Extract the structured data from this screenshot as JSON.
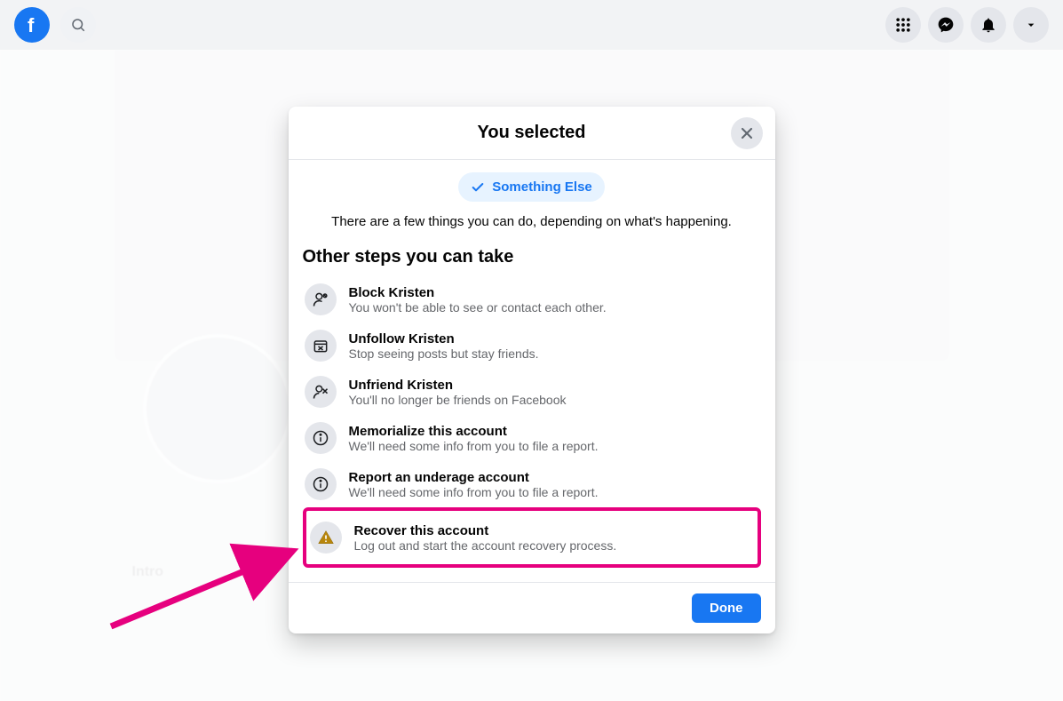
{
  "topbar": {
    "logo_letter": "f"
  },
  "profile": {
    "name": "Kristen",
    "info_label": "Intro"
  },
  "dialog": {
    "title": "You selected",
    "chip": "Something Else",
    "description": "There are a few things you can do, depending on what's happening.",
    "section": "Other steps you can take",
    "steps": [
      {
        "title": "Block Kristen",
        "sub": "You won't be able to see or contact each other."
      },
      {
        "title": "Unfollow Kristen",
        "sub": "Stop seeing posts but stay friends."
      },
      {
        "title": "Unfriend Kristen",
        "sub": "You'll no longer be friends on Facebook"
      },
      {
        "title": "Memorialize this account",
        "sub": "We'll need some info from you to file a report."
      },
      {
        "title": "Report an underage account",
        "sub": "We'll need some info from you to file a report."
      },
      {
        "title": "Recover this account",
        "sub": "Log out and start the account recovery process."
      }
    ],
    "done": "Done"
  }
}
